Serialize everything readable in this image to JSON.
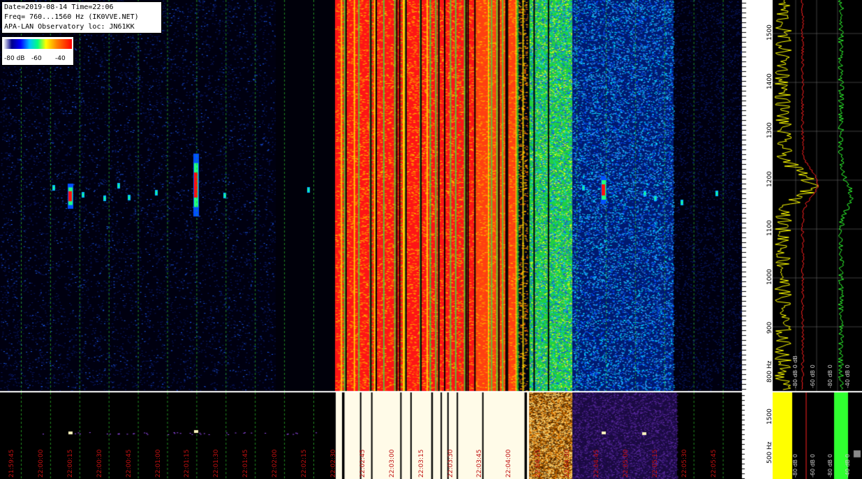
{
  "info": {
    "line1": "Date=2019-08-14 Time=22:06",
    "line2": "Freq= 760...1560 Hz (IK0VVE.NET)",
    "line3": "APA-LAN Observatory loc: JN61KK"
  },
  "scale": {
    "left": "-80 dB",
    "mid": "-60",
    "right": "-40"
  },
  "time_labels": [
    "21:59:45",
    "22:00:00",
    "22:00:15",
    "22:00:30",
    "22:00:45",
    "22:01:00",
    "22:01:15",
    "22:01:30",
    "22:01:45",
    "22:02:00",
    "22:02:15",
    "22:02:30",
    "22:02:45",
    "22:03:00",
    "22:03:15",
    "22:03:30",
    "22:03:45",
    "22:04:00",
    "22:04:15",
    "22:04:30",
    "22:04:45",
    "22:05:00",
    "22:05:15",
    "22:05:30",
    "22:05:45"
  ],
  "freq_labels": [
    "1500",
    "1400",
    "1300",
    "1200",
    "1100",
    "1000",
    "900",
    "800 Hz"
  ],
  "freq_labels_lower": [
    "1500",
    "500 Hz"
  ],
  "db_labels": [
    "-80 dB 0 dB",
    "-60 dB 0",
    "-80 dB 0",
    "-40 dB 0"
  ],
  "db_labels_lower": [
    "-80 dB 0",
    "-60 dB 0",
    "-80 dB 0",
    "-40 dB 0"
  ],
  "colors": {
    "scale_low": "#00008b",
    "scale_mid": "#00ff80",
    "scale_high": "#ff0000",
    "time_label": "#c01010",
    "yellow_trace": "#ffff00",
    "red_trace": "#ff2020",
    "green_trace": "#30ff30"
  }
}
